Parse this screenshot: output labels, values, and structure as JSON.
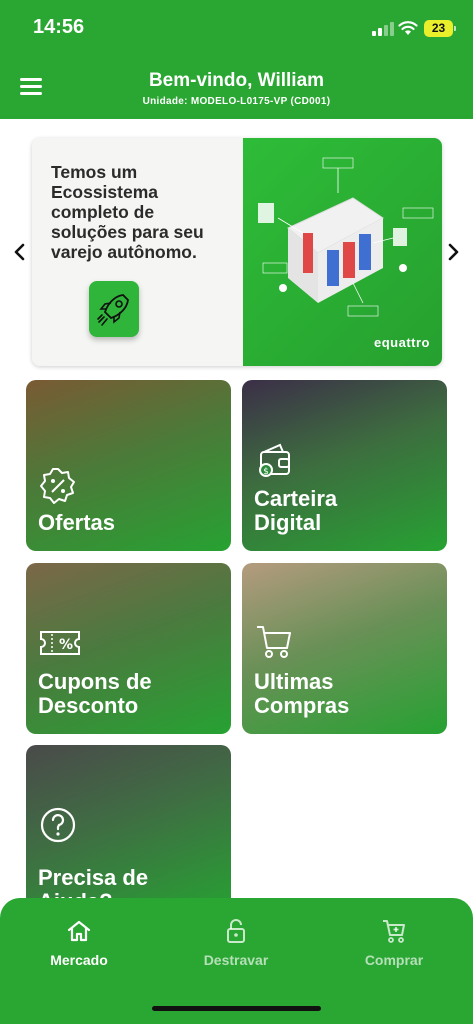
{
  "status_bar": {
    "time": "14:56",
    "battery": "23"
  },
  "header": {
    "title": "Bem-vindo, William",
    "subtitle": "Unidade: MODELO-L0175-VP (CD001)",
    "menu_icon": "hamburger-menu-icon"
  },
  "banner": {
    "text": "Temos um Ecossistema completo de soluções para seu varejo autônomo.",
    "brand": "equattro",
    "prev_icon": "chevron-left-icon",
    "next_icon": "chevron-right-icon"
  },
  "tiles": [
    {
      "label": "Ofertas",
      "icon": "discount-badge-icon"
    },
    {
      "label": "Carteira Digital",
      "icon": "wallet-icon"
    },
    {
      "label": "Cupons de Desconto",
      "icon": "coupon-icon"
    },
    {
      "label": "Ultimas Compras",
      "icon": "cart-icon"
    },
    {
      "label": "Precisa de Ajuda?",
      "icon": "help-icon"
    }
  ],
  "bottom_nav": [
    {
      "label": "Mercado",
      "icon": "home-icon",
      "active": true
    },
    {
      "label": "Destravar",
      "icon": "unlock-icon",
      "active": false
    },
    {
      "label": "Comprar",
      "icon": "cart-icon",
      "active": false
    }
  ],
  "colors": {
    "brand_green": "#2aa632",
    "battery_yellow": "#e9ef2b"
  }
}
